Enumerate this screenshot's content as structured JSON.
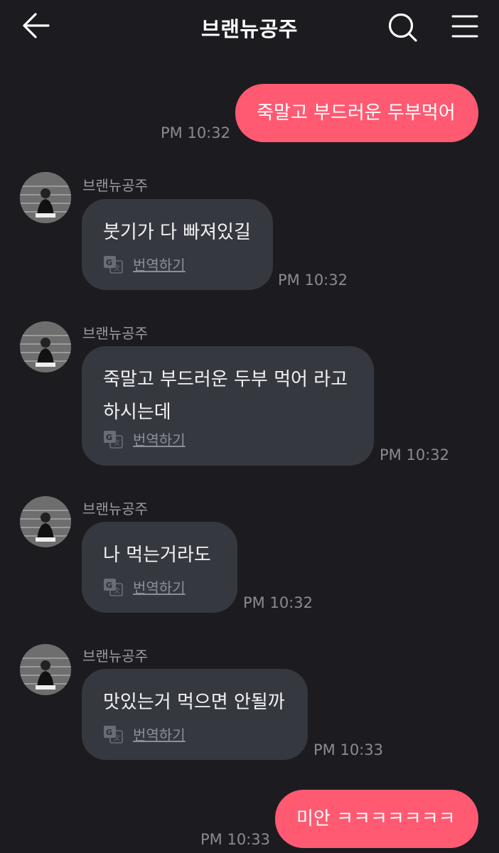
{
  "header": {
    "title": "브랜뉴공주"
  },
  "messages": [
    {
      "type": "out",
      "text": "죽말고 부드러운 두부먹어",
      "time": "PM 10:32"
    },
    {
      "type": "in",
      "sender": "브랜뉴공주",
      "text": "붓기가 다 빠져있길",
      "translate": "번역하기",
      "time": "PM 10:32"
    },
    {
      "type": "in",
      "sender": "브랜뉴공주",
      "text": "죽말고 부드러운 두부 먹어 라고\n하시는데",
      "translate": "번역하기",
      "time": "PM 10:32"
    },
    {
      "type": "in",
      "sender": "브랜뉴공주",
      "text": "나 먹는거라도",
      "translate": "번역하기",
      "time": "PM 10:32"
    },
    {
      "type": "in",
      "sender": "브랜뉴공주",
      "text": "맛있는거 먹으면 안될까",
      "translate": "번역하기",
      "time": "PM 10:33"
    },
    {
      "type": "out",
      "text": "미안 ㅋㅋㅋㅋㅋㅋㅋ",
      "time": "PM 10:33"
    }
  ],
  "icons": {
    "back": "arrow-left-icon",
    "search": "search-icon",
    "menu": "hamburger-menu-icon",
    "translate": "translate-icon"
  },
  "colors": {
    "background": "#1c1c20",
    "outgoing_bubble": "#ff5a72",
    "incoming_bubble": "#363840",
    "timestamp": "#8a8a90"
  }
}
